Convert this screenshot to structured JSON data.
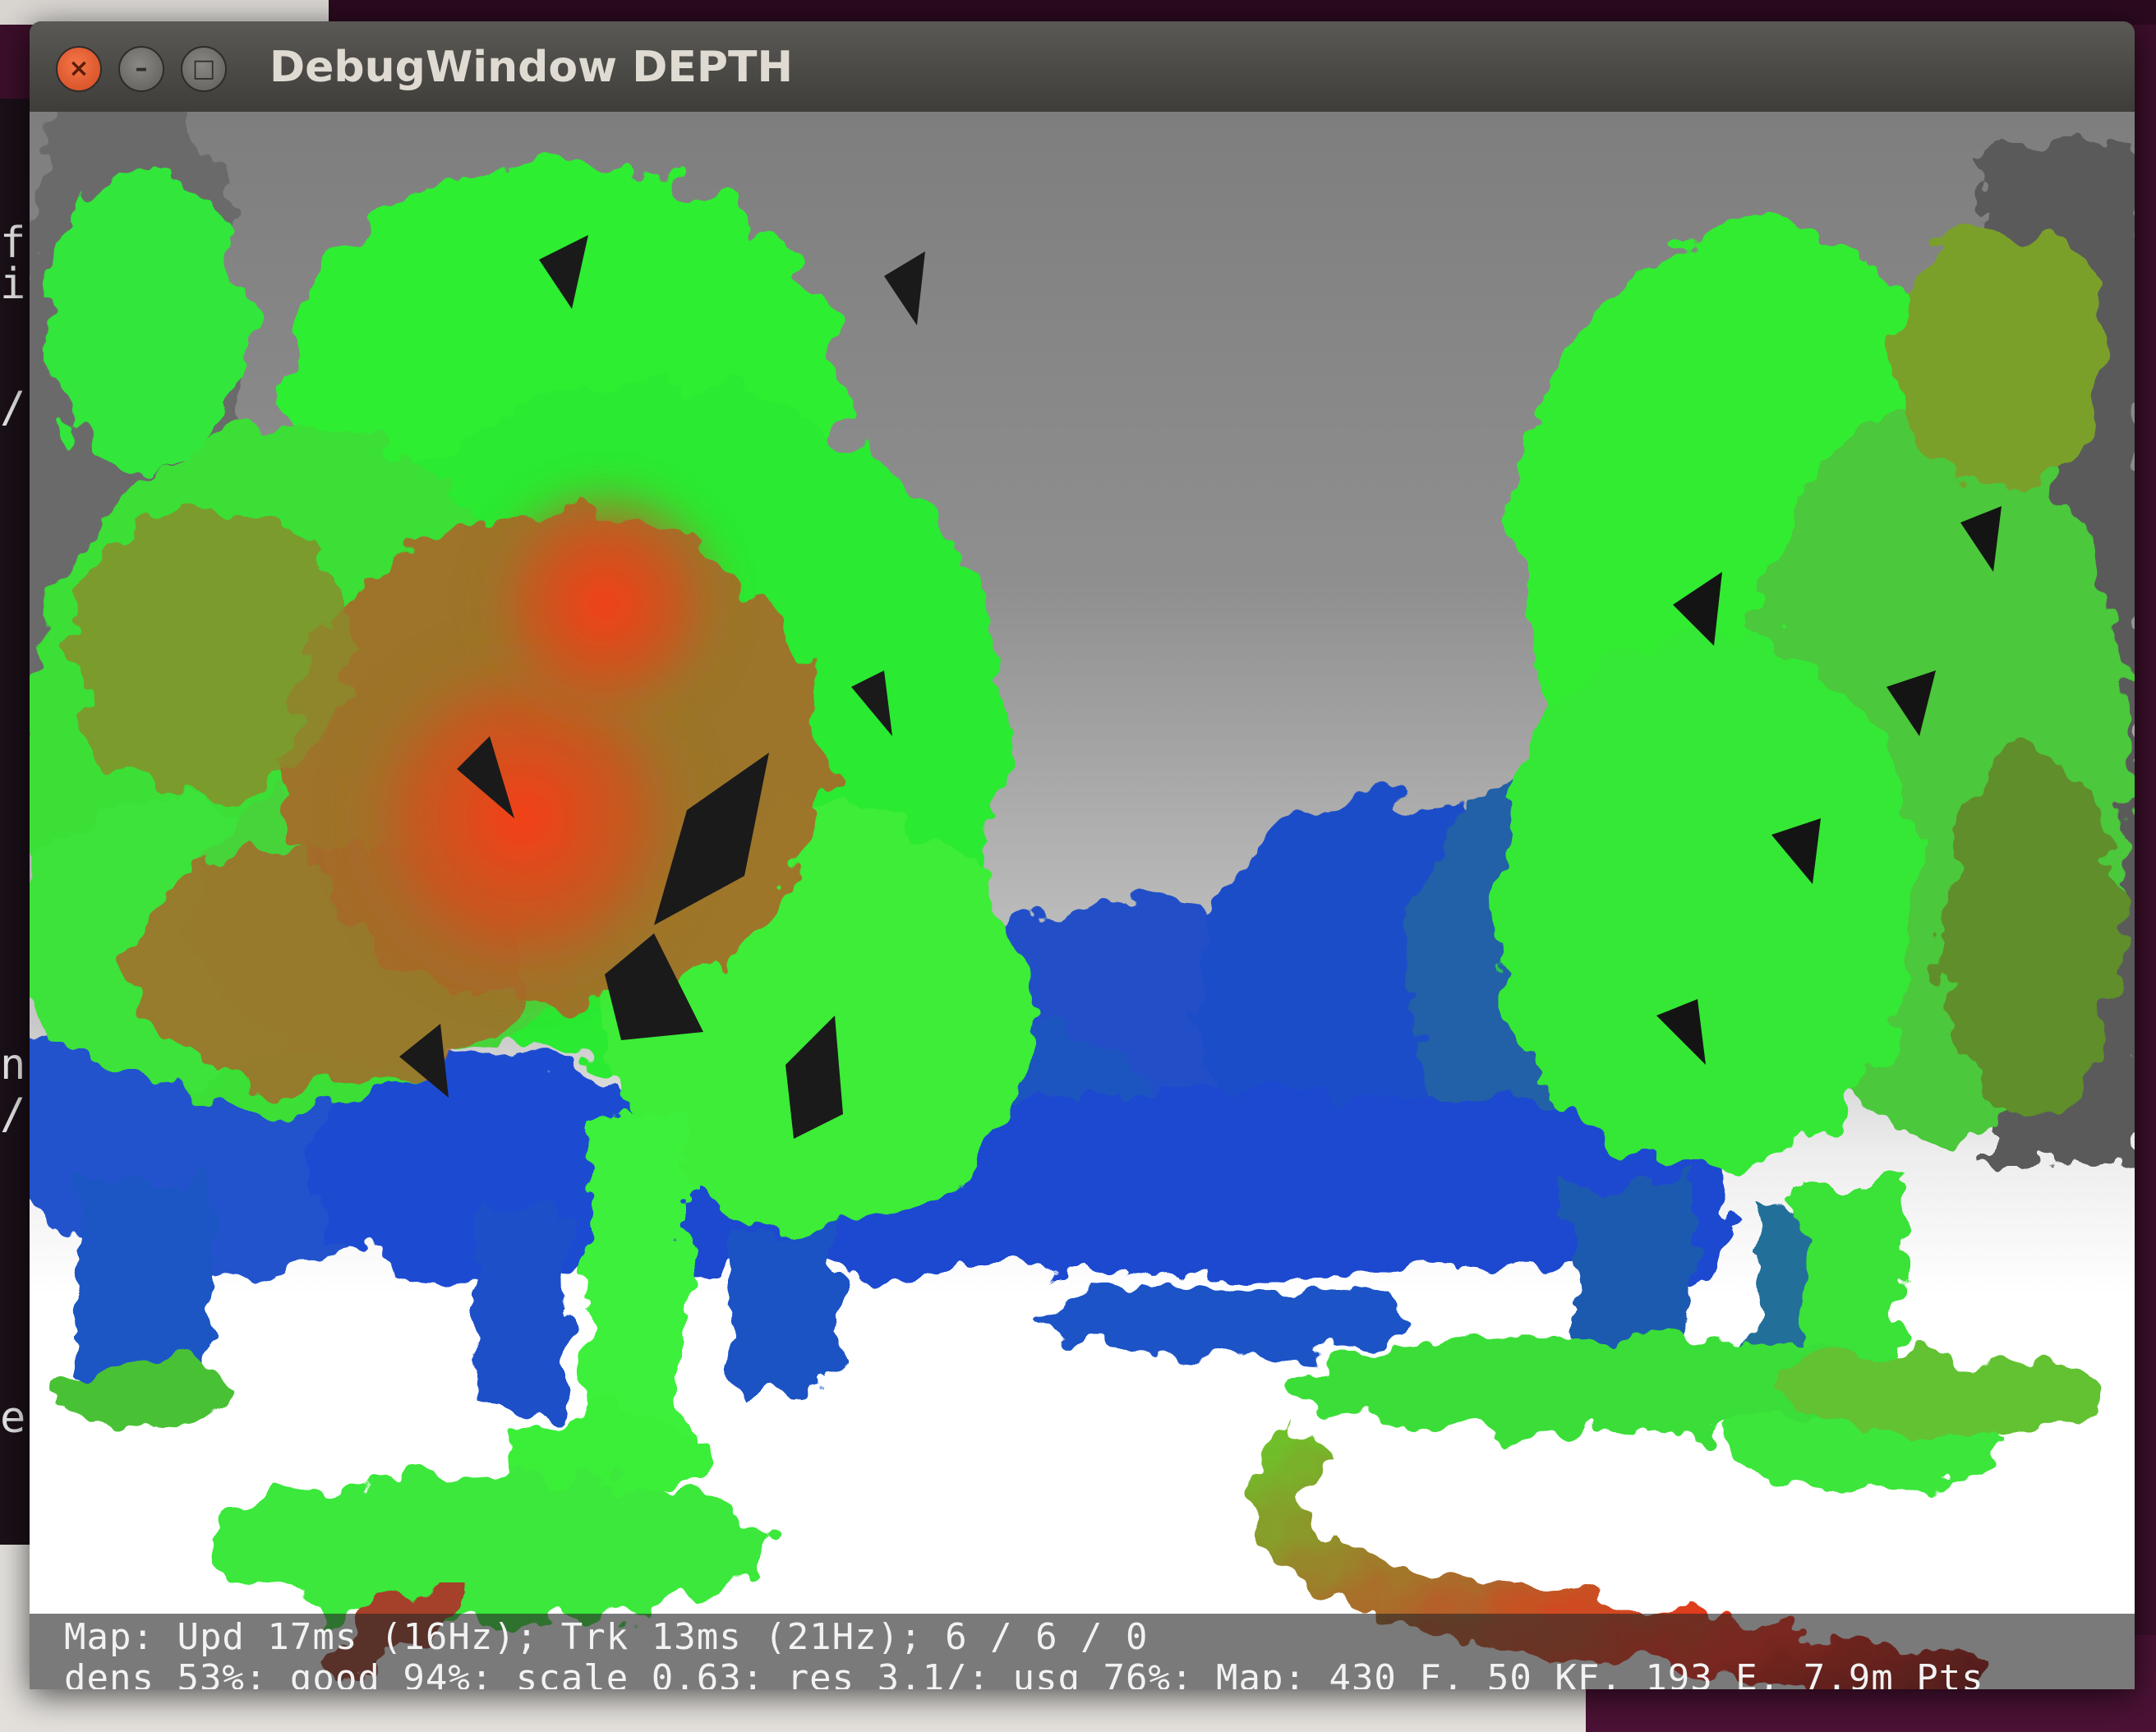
{
  "window": {
    "title": "DebugWindow DEPTH",
    "controls": {
      "close": "×",
      "minimize": "–",
      "maximize": "□"
    }
  },
  "status": {
    "line1": "Map: Upd  17ms (16Hz); Trk  13ms (21Hz); 6 / 6 / 0",
    "line2": "dens 53%; good 94%; scale 0.63; res 3.1/; usg 76%; Map: 430 F, 50 KF, 193 E, 7.9m Pts"
  },
  "terminal_fragments": [
    "f",
    "i",
    "/",
    "n",
    "/",
    "e"
  ],
  "colors": {
    "near": "#ff2a14",
    "mid_far": "#2ef02e",
    "far": "#1c4fd6",
    "sky": "#8a8a8a",
    "ground": "#ffffff",
    "titlebar": "#3e3d39",
    "close_button": "#e8582a",
    "desktop": "#3c0f2a"
  }
}
